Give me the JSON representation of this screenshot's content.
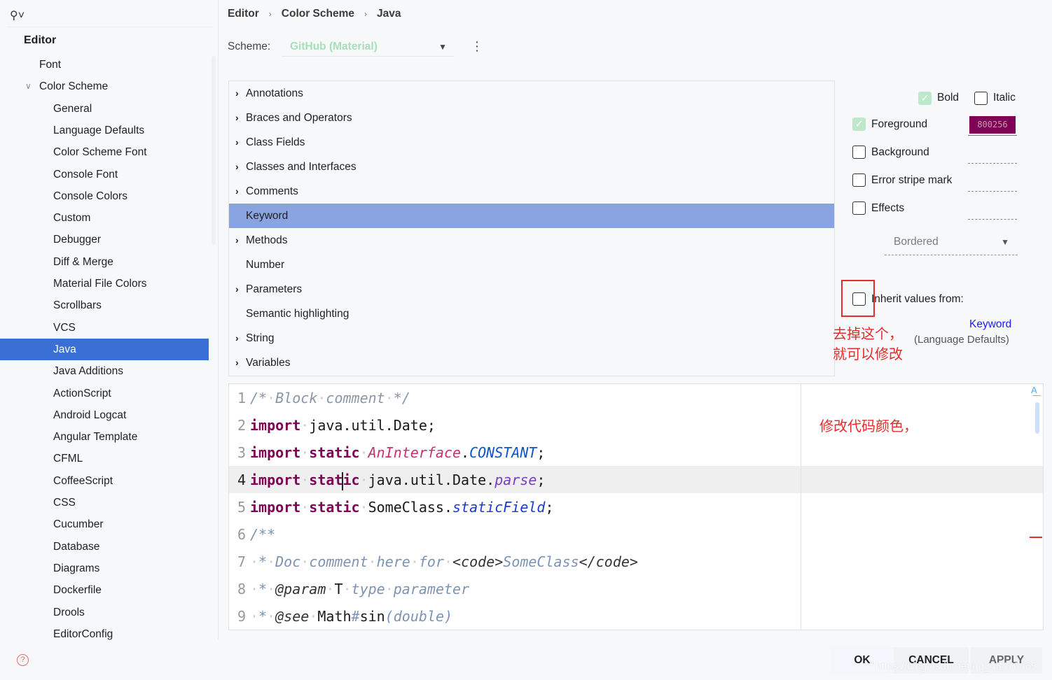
{
  "sidebar": {
    "title": "Editor",
    "items": [
      {
        "label": "Font",
        "level": 1
      },
      {
        "label": "Color Scheme",
        "level": 1,
        "expanded": true
      },
      {
        "label": "General",
        "level": 2
      },
      {
        "label": "Language Defaults",
        "level": 2
      },
      {
        "label": "Color Scheme Font",
        "level": 2
      },
      {
        "label": "Console Font",
        "level": 2
      },
      {
        "label": "Console Colors",
        "level": 2
      },
      {
        "label": "Custom",
        "level": 2
      },
      {
        "label": "Debugger",
        "level": 2
      },
      {
        "label": "Diff & Merge",
        "level": 2
      },
      {
        "label": "Material File Colors",
        "level": 2
      },
      {
        "label": "Scrollbars",
        "level": 2
      },
      {
        "label": "VCS",
        "level": 2
      },
      {
        "label": "Java",
        "level": 2,
        "selected": true
      },
      {
        "label": "Java Additions",
        "level": 2
      },
      {
        "label": "ActionScript",
        "level": 2
      },
      {
        "label": "Android Logcat",
        "level": 2
      },
      {
        "label": "Angular Template",
        "level": 2
      },
      {
        "label": "CFML",
        "level": 2
      },
      {
        "label": "CoffeeScript",
        "level": 2
      },
      {
        "label": "CSS",
        "level": 2
      },
      {
        "label": "Cucumber",
        "level": 2
      },
      {
        "label": "Database",
        "level": 2
      },
      {
        "label": "Diagrams",
        "level": 2
      },
      {
        "label": "Dockerfile",
        "level": 2
      },
      {
        "label": "Drools",
        "level": 2
      },
      {
        "label": "EditorConfig",
        "level": 2
      }
    ]
  },
  "breadcrumb": [
    "Editor",
    "Color Scheme",
    "Java"
  ],
  "scheme": {
    "label": "Scheme:",
    "value": "GitHub (Material)"
  },
  "tree": [
    {
      "label": "Annotations",
      "expandable": true
    },
    {
      "label": "Braces and Operators",
      "expandable": true
    },
    {
      "label": "Class Fields",
      "expandable": true
    },
    {
      "label": "Classes and Interfaces",
      "expandable": true
    },
    {
      "label": "Comments",
      "expandable": true
    },
    {
      "label": "Keyword",
      "expandable": false,
      "selected": true
    },
    {
      "label": "Methods",
      "expandable": true
    },
    {
      "label": "Number",
      "expandable": false
    },
    {
      "label": "Parameters",
      "expandable": true
    },
    {
      "label": "Semantic highlighting",
      "expandable": false
    },
    {
      "label": "String",
      "expandable": true
    },
    {
      "label": "Variables",
      "expandable": true
    }
  ],
  "options": {
    "bold": {
      "label": "Bold",
      "checked": true
    },
    "italic": {
      "label": "Italic",
      "checked": false
    },
    "foreground": {
      "label": "Foreground",
      "checked": true,
      "color": "800256"
    },
    "background": {
      "label": "Background",
      "checked": false
    },
    "error_stripe": {
      "label": "Error stripe mark",
      "checked": false
    },
    "effects": {
      "label": "Effects",
      "checked": false
    },
    "effect_type": "Bordered",
    "inherit": {
      "label": "Inherit values from:",
      "checked": false,
      "link": "Keyword",
      "source": "(Language Defaults)"
    }
  },
  "annotations": {
    "note1_line1": "去掉这个，",
    "note1_line2": "就可以修改",
    "note2": "修改代码颜色，"
  },
  "code": [
    [
      [
        "/*",
        "cm"
      ],
      [
        " ",
        "sp"
      ],
      [
        "Block",
        "cm"
      ],
      [
        " ",
        "sp"
      ],
      [
        "comment",
        "cm"
      ],
      [
        " ",
        "sp"
      ],
      [
        "*/",
        "cm"
      ]
    ],
    [
      [
        "import",
        "kw"
      ],
      [
        " ",
        "sp"
      ],
      [
        "java.util.Date;",
        "pl"
      ]
    ],
    [
      [
        "import",
        "kw"
      ],
      [
        " ",
        "sp"
      ],
      [
        "static",
        "kw"
      ],
      [
        " ",
        "sp"
      ],
      [
        "AnInterface",
        "itf"
      ],
      [
        ".",
        "pl"
      ],
      [
        "CONSTANT",
        "cst"
      ],
      [
        ";",
        "pl"
      ]
    ],
    [
      [
        "import",
        "kw"
      ],
      [
        " ",
        "sp"
      ],
      [
        "stat",
        "kw"
      ],
      [
        "|",
        "caret"
      ],
      [
        "ic",
        "kw"
      ],
      [
        " ",
        "sp"
      ],
      [
        "java.util.Date.",
        "pl"
      ],
      [
        "parse",
        "mth"
      ],
      [
        ";",
        "pl"
      ]
    ],
    [
      [
        "import",
        "kw"
      ],
      [
        " ",
        "sp"
      ],
      [
        "static",
        "kw"
      ],
      [
        " ",
        "sp"
      ],
      [
        "SomeClass.",
        "pl"
      ],
      [
        "staticField",
        "fld"
      ],
      [
        ";",
        "pl"
      ]
    ],
    [
      [
        "/**",
        "doc"
      ]
    ],
    [
      [
        " ",
        "sp"
      ],
      [
        "*",
        "doc"
      ],
      [
        " ",
        "sp"
      ],
      [
        "Doc",
        "doc"
      ],
      [
        " ",
        "sp"
      ],
      [
        "comment",
        "doc"
      ],
      [
        " ",
        "sp"
      ],
      [
        "here",
        "doc"
      ],
      [
        " ",
        "sp"
      ],
      [
        "for",
        "doc"
      ],
      [
        " ",
        "sp"
      ],
      [
        "<code>",
        "tag"
      ],
      [
        "SomeClass",
        "doc"
      ],
      [
        "</code>",
        "tag"
      ]
    ],
    [
      [
        " ",
        "sp"
      ],
      [
        "*",
        "doc"
      ],
      [
        " ",
        "sp"
      ],
      [
        "@param",
        "tag"
      ],
      [
        " ",
        "sp"
      ],
      [
        "T",
        "pl"
      ],
      [
        " ",
        "sp"
      ],
      [
        "type",
        "doc"
      ],
      [
        " ",
        "sp"
      ],
      [
        "parameter",
        "doc"
      ]
    ],
    [
      [
        " ",
        "sp"
      ],
      [
        "*",
        "doc"
      ],
      [
        " ",
        "sp"
      ],
      [
        "@see",
        "tag"
      ],
      [
        " ",
        "sp"
      ],
      [
        "Math",
        "pl"
      ],
      [
        "#",
        "doc"
      ],
      [
        "sin",
        "pl"
      ],
      [
        "(double)",
        "doc"
      ]
    ]
  ],
  "current_line": 4,
  "buttons": {
    "ok": "OK",
    "cancel": "CANCEL",
    "apply": "APPLY"
  },
  "watermark": "https://blog.csdn.net/qq_43476465",
  "colors": {
    "accent": "#3a6fd6",
    "tree_selection": "#8aa4e2",
    "keyword": "#800256",
    "annotation": "#e52c2c"
  }
}
